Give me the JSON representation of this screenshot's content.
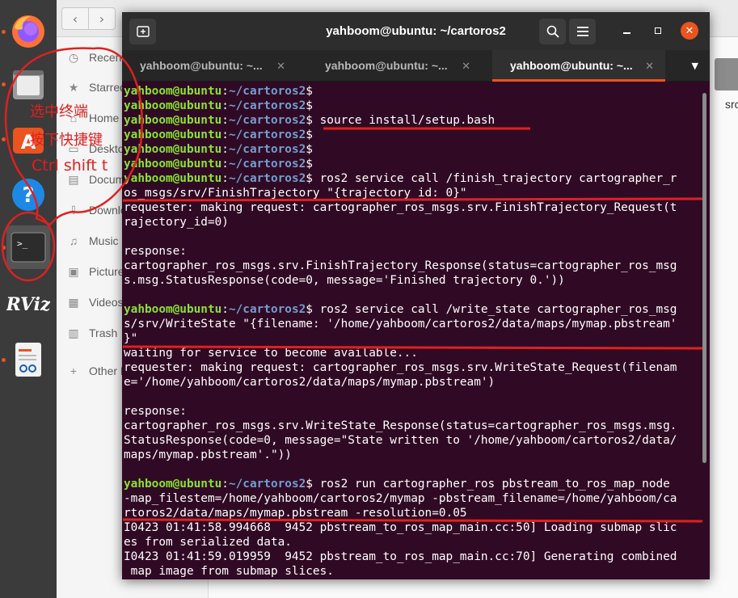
{
  "dock": {
    "apps": [
      {
        "name": "firefox"
      },
      {
        "name": "files"
      },
      {
        "name": "software-center"
      },
      {
        "name": "help"
      },
      {
        "name": "terminal"
      },
      {
        "name": "rviz",
        "label": "RViz"
      },
      {
        "name": "text-viewer"
      }
    ]
  },
  "file_manager": {
    "places": [
      {
        "label": "Recent",
        "icon": "clock-icon"
      },
      {
        "label": "Starred",
        "icon": "star-icon"
      },
      {
        "label": "Home",
        "icon": "home-icon"
      },
      {
        "label": "Desktop",
        "icon": "desktop-icon"
      },
      {
        "label": "Documents",
        "icon": "document-icon"
      },
      {
        "label": "Downloads",
        "icon": "download-icon"
      },
      {
        "label": "Music",
        "icon": "music-icon"
      },
      {
        "label": "Pictures",
        "icon": "picture-icon"
      },
      {
        "label": "Videos",
        "icon": "video-icon"
      },
      {
        "label": "Trash",
        "icon": "trash-icon"
      },
      {
        "label": "Other Locations",
        "icon": "plus-icon"
      }
    ],
    "folder_label": "src"
  },
  "terminal": {
    "title": "yahboom@ubuntu: ~/cartoros2",
    "tabs": [
      {
        "label": "yahboom@ubuntu: ~...",
        "active": false
      },
      {
        "label": "yahboom@ubuntu: ~...",
        "active": false
      },
      {
        "label": "yahboom@ubuntu: ~...",
        "active": true
      }
    ],
    "prompt_user": "yahboom@ubuntu",
    "prompt_path": "~/cartoros2",
    "lines": [
      {
        "kind": "prompt",
        "cmd": ""
      },
      {
        "kind": "prompt",
        "cmd": ""
      },
      {
        "kind": "prompt",
        "cmd": " source install/setup.bash"
      },
      {
        "kind": "prompt",
        "cmd": ""
      },
      {
        "kind": "prompt",
        "cmd": ""
      },
      {
        "kind": "prompt",
        "cmd": ""
      },
      {
        "kind": "prompt",
        "cmd": " ros2 service call /finish_trajectory cartographer_r"
      },
      {
        "kind": "text",
        "text": "os_msgs/srv/FinishTrajectory \"{trajectory_id: 0}\""
      },
      {
        "kind": "text",
        "text": "requester: making request: cartographer_ros_msgs.srv.FinishTrajectory_Request(t"
      },
      {
        "kind": "text",
        "text": "rajectory_id=0)"
      },
      {
        "kind": "text",
        "text": ""
      },
      {
        "kind": "text",
        "text": "response:"
      },
      {
        "kind": "text",
        "text": "cartographer_ros_msgs.srv.FinishTrajectory_Response(status=cartographer_ros_msg"
      },
      {
        "kind": "text",
        "text": "s.msg.StatusResponse(code=0, message='Finished trajectory 0.'))"
      },
      {
        "kind": "text",
        "text": ""
      },
      {
        "kind": "prompt",
        "cmd": " ros2 service call /write_state cartographer_ros_msg"
      },
      {
        "kind": "text",
        "text": "s/srv/WriteState \"{filename: '/home/yahboom/cartoros2/data/maps/mymap.pbstream'"
      },
      {
        "kind": "text",
        "text": "}\""
      },
      {
        "kind": "text",
        "text": "waiting for service to become available..."
      },
      {
        "kind": "text",
        "text": "requester: making request: cartographer_ros_msgs.srv.WriteState_Request(filenam"
      },
      {
        "kind": "text",
        "text": "e='/home/yahboom/cartoros2/data/maps/mymap.pbstream')"
      },
      {
        "kind": "text",
        "text": ""
      },
      {
        "kind": "text",
        "text": "response:"
      },
      {
        "kind": "text",
        "text": "cartographer_ros_msgs.srv.WriteState_Response(status=cartographer_ros_msgs.msg."
      },
      {
        "kind": "text",
        "text": "StatusResponse(code=0, message=\"State written to '/home/yahboom/cartoros2/data/"
      },
      {
        "kind": "text",
        "text": "maps/mymap.pbstream'.\"))"
      },
      {
        "kind": "text",
        "text": ""
      },
      {
        "kind": "prompt",
        "cmd": " ros2 run cartographer_ros pbstream_to_ros_map_node"
      },
      {
        "kind": "text",
        "text": "-map_filestem=/home/yahboom/cartoros2/mymap -pbstream_filename=/home/yahboom/ca"
      },
      {
        "kind": "text",
        "text": "rtoros2/data/maps/mymap.pbstream -resolution=0.05"
      },
      {
        "kind": "text",
        "text": "I0423 01:41:58.994668  9452 pbstream_to_ros_map_main.cc:50] Loading submap slic"
      },
      {
        "kind": "text",
        "text": "es from serialized data."
      },
      {
        "kind": "text",
        "text": "I0423 01:41:59.019959  9452 pbstream_to_ros_map_main.cc:70] Generating combined"
      },
      {
        "kind": "text",
        "text": " map image from submap slices."
      }
    ]
  },
  "annotation": {
    "color": "#e02020",
    "lines": [
      "选中终端",
      "按下快捷键",
      "Ctrl shift t"
    ]
  },
  "colors": {
    "terminal_bg": "#300a24",
    "prompt_user": "#8ae234",
    "prompt_path": "#729fcf",
    "accent": "#e95420",
    "annotation": "#e02020"
  }
}
